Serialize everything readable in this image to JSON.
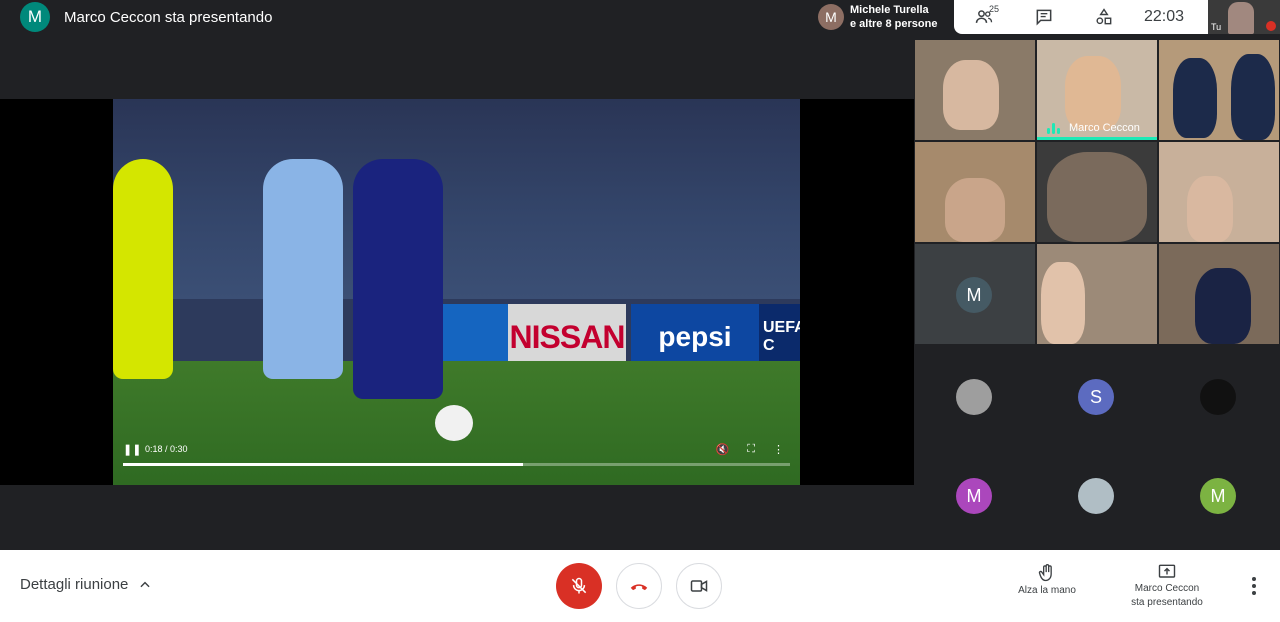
{
  "presenter_banner": {
    "avatar_letter": "M",
    "avatar_color": "#00897b",
    "title": "Marco Ceccon sta presentando"
  },
  "participants_chip": {
    "avatar_letter": "M",
    "line1": "Michele Turella",
    "line2": "e altre 8 persone"
  },
  "top_panel": {
    "people_count": "25",
    "people_icon": "people-icon",
    "chat_icon": "chat-icon",
    "activities_icon": "activities-icon",
    "clock": "22:03"
  },
  "self_view": {
    "label": "Tu",
    "mic_state": "muted"
  },
  "video": {
    "ads": {
      "nissan": "NISSAN",
      "pepsi": "pepsi",
      "uefa": "UEFA C"
    },
    "controls": {
      "time": "0:18 / 0:30",
      "progress": 0.6,
      "play_state": "playing"
    }
  },
  "grid": {
    "speaking_name": "Marco Ceccon",
    "avatars": [
      {
        "letter": "M",
        "color": "#455a64"
      },
      {
        "letter": "S",
        "color": "#5c6bc0"
      },
      {
        "letter": "M",
        "color": "#ab47bc"
      },
      {
        "letter": "M",
        "color": "#7cb342"
      }
    ]
  },
  "bottom_bar": {
    "details_label": "Dettagli riunione",
    "raise_hand_label": "Alza la mano",
    "presenting_line1": "Marco Ceccon",
    "presenting_line2": "sta presentando"
  },
  "colors": {
    "accent_speaking": "#1de9b6",
    "mic_muted": "#d93025",
    "hangup": "#d93025"
  }
}
